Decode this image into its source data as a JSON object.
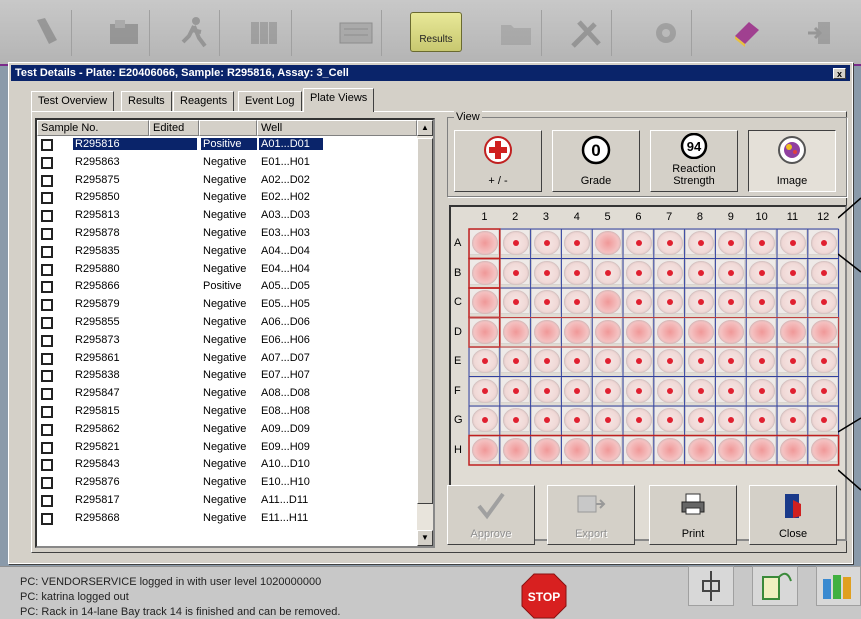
{
  "toolbar": {
    "results_label": "Results",
    "icons": [
      "tube-icon",
      "rack-scan-icon",
      "runner-icon",
      "plates-icon",
      "keyboard-icon",
      "results-folder-icon",
      "folder-icon",
      "tools-icon",
      "gear-icon",
      "book-icon",
      "exit-icon"
    ]
  },
  "window": {
    "title": "Test Details - Plate: E20406066, Sample: R295816, Assay: 3_Cell",
    "close": "x"
  },
  "tabs": [
    {
      "label": "Test Overview"
    },
    {
      "label": "Results"
    },
    {
      "label": "Reagents"
    },
    {
      "label": "Event Log"
    },
    {
      "label": "Plate Views",
      "active": true
    }
  ],
  "list": {
    "headers": [
      "Sample No.",
      "Edited",
      "",
      "Well"
    ],
    "rows": [
      {
        "sample": "R295816",
        "result": "Positive",
        "well": "A01...D01",
        "selected": true
      },
      {
        "sample": "R295863",
        "result": "Negative",
        "well": "E01...H01"
      },
      {
        "sample": "R295875",
        "result": "Negative",
        "well": "A02...D02"
      },
      {
        "sample": "R295850",
        "result": "Negative",
        "well": "E02...H02"
      },
      {
        "sample": "R295813",
        "result": "Negative",
        "well": "A03...D03"
      },
      {
        "sample": "R295878",
        "result": "Negative",
        "well": "E03...H03"
      },
      {
        "sample": "R295835",
        "result": "Negative",
        "well": "A04...D04"
      },
      {
        "sample": "R295880",
        "result": "Negative",
        "well": "E04...H04"
      },
      {
        "sample": "R295866",
        "result": "Positive",
        "well": "A05...D05"
      },
      {
        "sample": "R295879",
        "result": "Negative",
        "well": "E05...H05"
      },
      {
        "sample": "R295855",
        "result": "Negative",
        "well": "A06...D06"
      },
      {
        "sample": "R295873",
        "result": "Negative",
        "well": "E06...H06"
      },
      {
        "sample": "R295861",
        "result": "Negative",
        "well": "A07...D07"
      },
      {
        "sample": "R295838",
        "result": "Negative",
        "well": "E07...H07"
      },
      {
        "sample": "R295847",
        "result": "Negative",
        "well": "A08...D08"
      },
      {
        "sample": "R295815",
        "result": "Negative",
        "well": "E08...H08"
      },
      {
        "sample": "R295862",
        "result": "Negative",
        "well": "A09...D09"
      },
      {
        "sample": "R295821",
        "result": "Negative",
        "well": "E09...H09"
      },
      {
        "sample": "R295843",
        "result": "Negative",
        "well": "A10...D10"
      },
      {
        "sample": "R295876",
        "result": "Negative",
        "well": "E10...H10"
      },
      {
        "sample": "R295817",
        "result": "Negative",
        "well": "A11...D11"
      },
      {
        "sample": "R295868",
        "result": "Negative",
        "well": "E11...H11"
      }
    ]
  },
  "view": {
    "group_label": "View",
    "buttons": [
      {
        "label": "+ / -",
        "icon": "plus-minus-icon"
      },
      {
        "label": "Grade",
        "icon_text": "0"
      },
      {
        "label": "Reaction\nStrength",
        "icon_text": "94"
      },
      {
        "label": "Image",
        "icon": "image-icon",
        "pressed": true
      }
    ]
  },
  "plate": {
    "columns": [
      "1",
      "2",
      "3",
      "4",
      "5",
      "6",
      "7",
      "8",
      "9",
      "10",
      "11",
      "12"
    ],
    "rows": [
      "A",
      "B",
      "C",
      "D",
      "E",
      "F",
      "G",
      "H"
    ],
    "diffuse_rows": [
      "D",
      "H"
    ],
    "diffuse_wells": [
      "A1",
      "A5",
      "B1",
      "C1",
      "C5"
    ]
  },
  "actions": [
    {
      "label": "Approve",
      "icon": "checkmark-icon",
      "disabled": true
    },
    {
      "label": "Export",
      "icon": "export-icon",
      "disabled": true
    },
    {
      "label": "Print",
      "icon": "printer-icon"
    },
    {
      "label": "Close",
      "icon": "door-exit-icon"
    }
  ],
  "status": {
    "log": [
      "PC: VENDORSERVICE logged in with user level 1020000000",
      "PC: katrina logged out",
      "PC: Rack in 14-lane Bay track 14 is finished and can be removed."
    ],
    "stop_label": "STOP"
  },
  "colors": {
    "title_bar": "#0a246a",
    "accent_purple": "#7a2a8a",
    "well_dot": "#e02030"
  }
}
